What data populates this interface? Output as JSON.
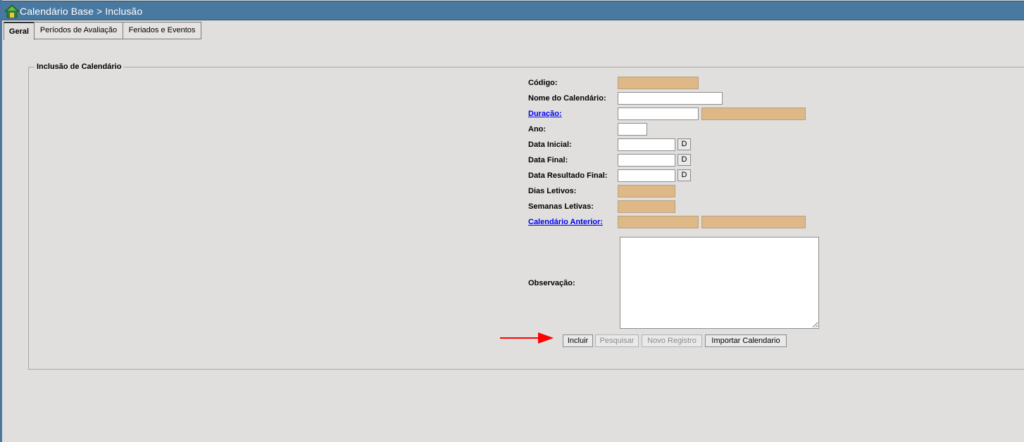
{
  "window": {
    "title": "Calendário Base > Inclusão"
  },
  "tabs": [
    {
      "label": "Geral",
      "active": true
    },
    {
      "label": "Períodos de Avaliação",
      "active": false
    },
    {
      "label": "Feriados e Eventos",
      "active": false
    }
  ],
  "form": {
    "legend": "Inclusão de Calendário",
    "fields": {
      "codigo": {
        "label": "Código:",
        "value": ""
      },
      "nome": {
        "label": "Nome do Calendário:",
        "value": ""
      },
      "duracao": {
        "label": "Duração:",
        "value": "",
        "description": ""
      },
      "ano": {
        "label": "Ano:",
        "value": ""
      },
      "data_inicial": {
        "label": "Data Inicial:",
        "value": "",
        "button": "D"
      },
      "data_final": {
        "label": "Data Final:",
        "value": "",
        "button": "D"
      },
      "data_resultado_final": {
        "label": "Data Resultado Final:",
        "value": "",
        "button": "D"
      },
      "dias_letivos": {
        "label": "Dias Letivos:",
        "value": ""
      },
      "semanas_letivas": {
        "label": "Semanas Letivas:",
        "value": ""
      },
      "calendario_anterior": {
        "label": "Calendário Anterior:",
        "value": "",
        "description": ""
      },
      "observacao": {
        "label": "Observação:",
        "value": ""
      }
    },
    "actions": {
      "incluir": "Incluir",
      "pesquisar": "Pesquisar",
      "novo_registro": "Novo Registro",
      "importar": "Importar Calendario"
    }
  },
  "colors": {
    "titlebar": "#4978a1",
    "readonly_field": "#deb887",
    "background": "#e0dfdd",
    "link": "#0000ee",
    "annotation_arrow": "#ff0000"
  }
}
